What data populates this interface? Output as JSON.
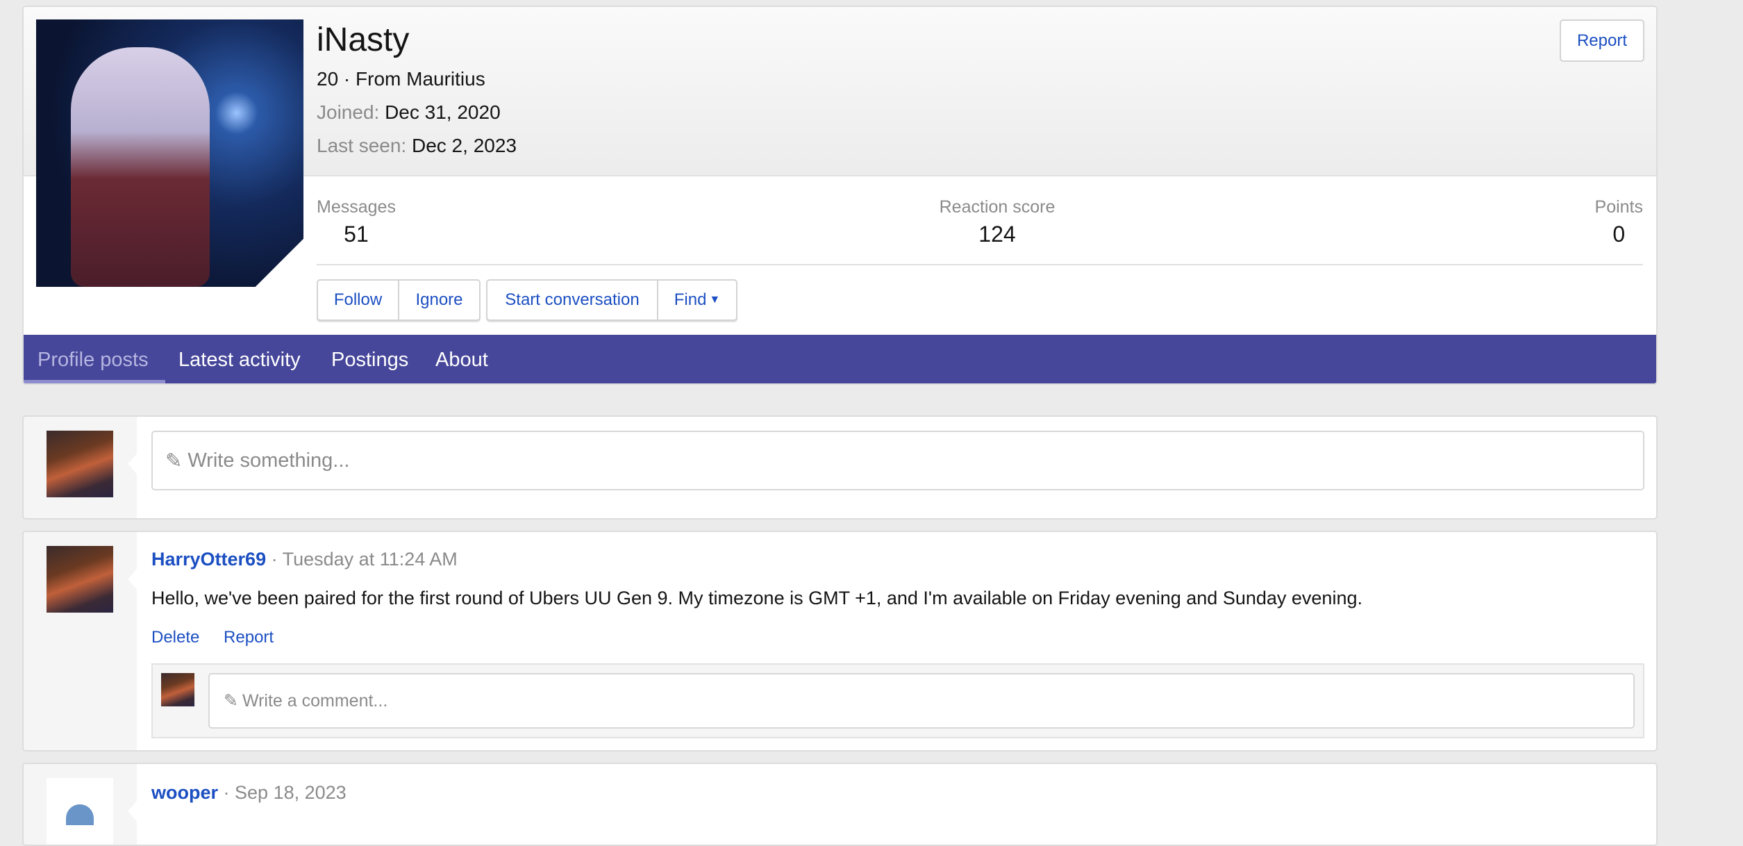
{
  "profile": {
    "username": "iNasty",
    "age_location": "20 · From Mauritius",
    "joined_label": "Joined:",
    "joined_value": "Dec 31, 2020",
    "last_seen_label": "Last seen:",
    "last_seen_value": "Dec 2, 2023",
    "report_label": "Report",
    "stats": [
      {
        "label": "Messages",
        "value": "51"
      },
      {
        "label": "Reaction score",
        "value": "124"
      },
      {
        "label": "Points",
        "value": "0"
      }
    ],
    "actions": {
      "follow": "Follow",
      "ignore": "Ignore",
      "start_conversation": "Start conversation",
      "find": "Find"
    }
  },
  "tabs": [
    {
      "label": "Profile posts",
      "active": true
    },
    {
      "label": "Latest activity"
    },
    {
      "label": "Postings"
    },
    {
      "label": "About"
    }
  ],
  "composer": {
    "placeholder": "Write something..."
  },
  "posts": [
    {
      "author": "HarryOtter69",
      "time": "Tuesday at 11:24 AM",
      "body": "Hello, we've been paired for the first round of Ubers UU Gen 9. My timezone is GMT +1, and I'm available on Friday evening and Sunday evening.",
      "delete_label": "Delete",
      "report_label": "Report",
      "comment_placeholder": "Write a comment..."
    },
    {
      "author": "wooper",
      "time": "Sep 18, 2023"
    }
  ],
  "colors": {
    "accent": "#46469a",
    "link": "#1c4fc2",
    "tab_underline": "#8e8ecf"
  }
}
